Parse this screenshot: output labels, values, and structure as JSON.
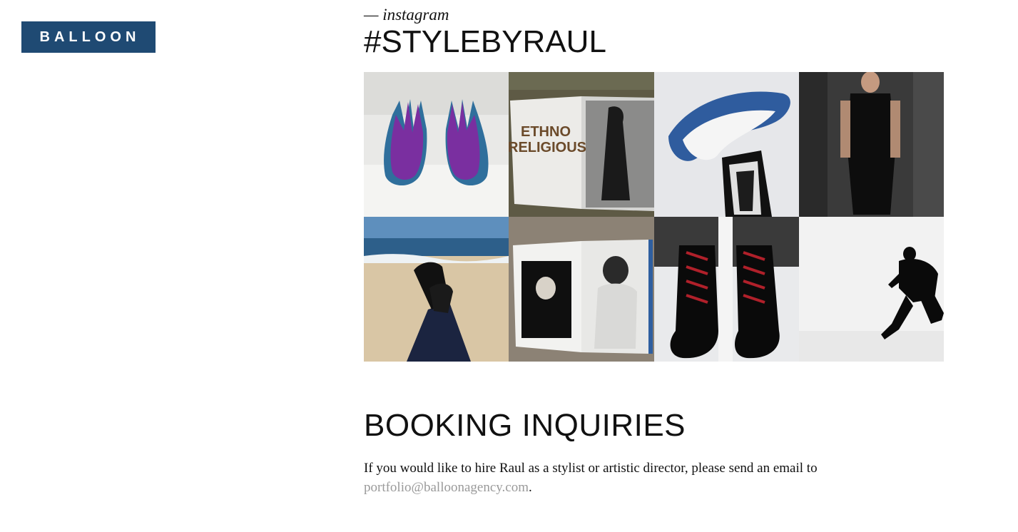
{
  "header": {
    "logo_text": "BALLOON"
  },
  "instagram": {
    "kicker": "— instagram",
    "hashtag": "#STYLEBYRAUL",
    "tiles": [
      {
        "name": "photo-purple-gloves"
      },
      {
        "name": "photo-ethno-religious-book",
        "text": "ETHNO\nRELIGIOUS"
      },
      {
        "name": "photo-white-blue-sculpture"
      },
      {
        "name": "photo-runway-model"
      },
      {
        "name": "photo-beach-boots"
      },
      {
        "name": "photo-portrait-book"
      },
      {
        "name": "photo-black-boots-red-laces"
      },
      {
        "name": "photo-running-silhouette"
      }
    ]
  },
  "booking": {
    "title": "BOOKING INQUIRIES",
    "text": "If you would like to hire Raul as a stylist or artistic director, please send an email to",
    "email": "portfolio@balloonagency.com",
    "period": "."
  },
  "colors": {
    "brand": "#1f4a73",
    "link": "#9a9a9a"
  }
}
